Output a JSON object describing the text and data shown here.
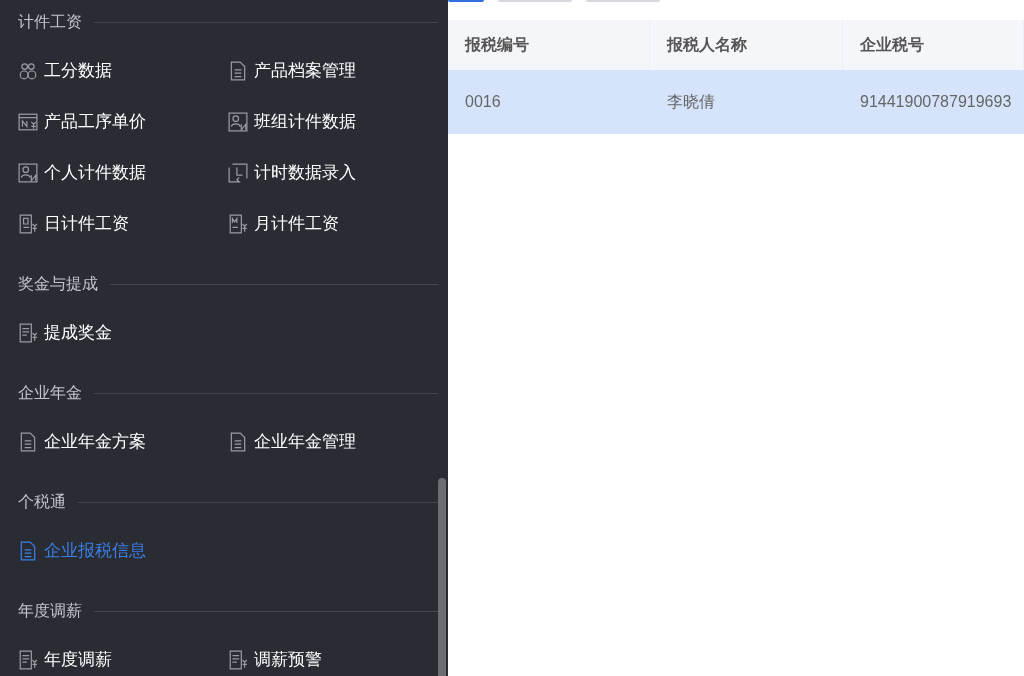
{
  "toolbar": {
    "buttons": [
      {
        "selected": true
      },
      {
        "selected": false
      },
      {
        "selected": false
      }
    ]
  },
  "menu": {
    "sections": [
      {
        "title": "计件工资",
        "items": [
          {
            "label": "工分数据",
            "selected": false
          },
          {
            "label": "产品档案管理",
            "selected": false
          },
          {
            "label": "产品工序单价",
            "selected": false
          },
          {
            "label": "班组计件数据",
            "selected": false
          },
          {
            "label": "个人计件数据",
            "selected": false
          },
          {
            "label": "计时数据录入",
            "selected": false
          },
          {
            "label": "日计件工资",
            "selected": false
          },
          {
            "label": "月计件工资",
            "selected": false
          }
        ]
      },
      {
        "title": "奖金与提成",
        "items": [
          {
            "label": "提成奖金",
            "selected": false
          }
        ]
      },
      {
        "title": "企业年金",
        "items": [
          {
            "label": "企业年金方案",
            "selected": false
          },
          {
            "label": "企业年金管理",
            "selected": false
          }
        ]
      },
      {
        "title": "个税通",
        "items": [
          {
            "label": "企业报税信息",
            "selected": true
          }
        ]
      },
      {
        "title": "年度调薪",
        "items": [
          {
            "label": "年度调薪",
            "selected": false
          },
          {
            "label": "调薪预警",
            "selected": false
          }
        ]
      }
    ]
  },
  "table": {
    "columns": [
      "报税编号",
      "报税人名称",
      "企业税号"
    ],
    "rows": [
      {
        "selected": true,
        "cells": [
          "0016",
          "李晓倩",
          "91441900787919693"
        ]
      }
    ]
  }
}
